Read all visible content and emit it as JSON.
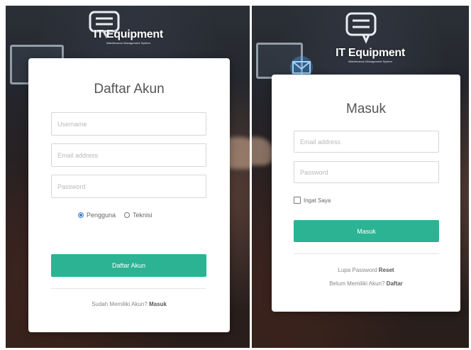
{
  "brand": {
    "title": "IT Equipment",
    "subtitle": "Maintenance Management System"
  },
  "register": {
    "title": "Daftar Akun",
    "username_placeholder": "Username",
    "email_placeholder": "Email address",
    "password_placeholder": "Password",
    "role_options": [
      "Pengguna",
      "Teknisi"
    ],
    "selected_role": "Pengguna",
    "submit_label": "Daftar Akun",
    "footer_text": "Sudah Memiliki Akun?",
    "footer_link": "Masuk"
  },
  "login": {
    "title": "Masuk",
    "email_placeholder": "Email address",
    "password_placeholder": "Password",
    "remember_label": "Ingat Saya",
    "submit_label": "Masuk",
    "forgot_text": "Lupa Password",
    "forgot_link": "Reset",
    "register_text": "Belum Memiliki Akun?",
    "register_link": "Daftar"
  },
  "colors": {
    "accent": "#2bb393",
    "radio_selected": "#3a7bd5",
    "card_bg": "#ffffff"
  }
}
